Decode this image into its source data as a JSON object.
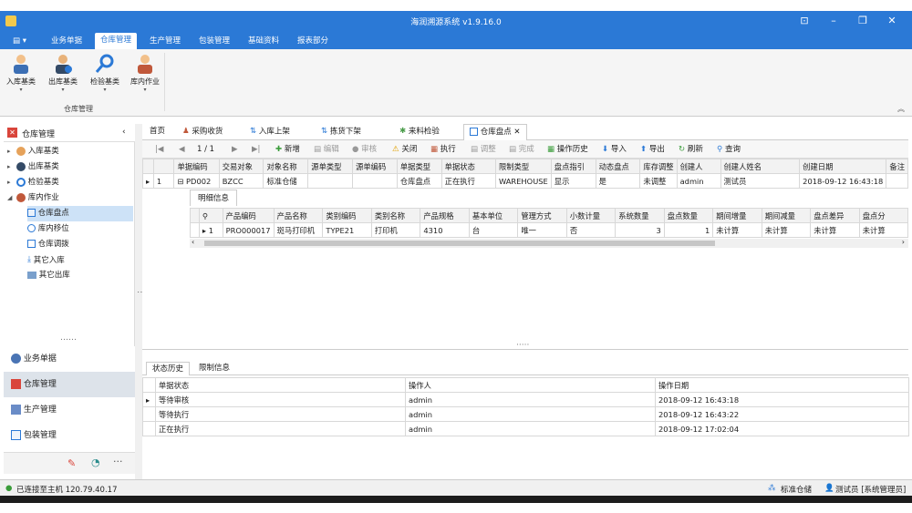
{
  "window": {
    "title": "海润溯源系统 v1.9.16.0"
  },
  "menu": {
    "items": [
      "业务单据",
      "仓库管理",
      "生产管理",
      "包装管理",
      "基础资料",
      "报表部分"
    ],
    "active": 1
  },
  "ribbon": {
    "buttons": [
      "入库基类",
      "出库基类",
      "检验基类",
      "库内作业"
    ],
    "group_label": "仓库管理"
  },
  "left": {
    "header": "仓库管理",
    "tree": [
      {
        "label": "入库基类",
        "level": 0,
        "expanded": false
      },
      {
        "label": "出库基类",
        "level": 0,
        "expanded": false
      },
      {
        "label": "检验基类",
        "level": 0,
        "expanded": false
      },
      {
        "label": "库内作业",
        "level": 0,
        "expanded": true
      },
      {
        "label": "仓库盘点",
        "level": 1,
        "selected": true
      },
      {
        "label": "库内移位",
        "level": 1
      },
      {
        "label": "仓库调拨",
        "level": 1
      },
      {
        "label": "其它入库",
        "level": 1
      },
      {
        "label": "其它出库",
        "level": 1
      }
    ],
    "nav": [
      "业务单据",
      "仓库管理",
      "生产管理",
      "包装管理"
    ],
    "nav_active": 1
  },
  "tabs": {
    "items": [
      "首页",
      "采购收货",
      "入库上架",
      "拣货下架",
      "来料检验",
      "仓库盘点"
    ],
    "active": 5
  },
  "toolbar": {
    "pager": "1 / 1",
    "buttons": [
      {
        "label": "新增",
        "enabled": true
      },
      {
        "label": "编辑",
        "enabled": false
      },
      {
        "label": "审核",
        "enabled": false
      },
      {
        "label": "关闭",
        "enabled": true
      },
      {
        "label": "执行",
        "enabled": true
      },
      {
        "label": "调整",
        "enabled": false
      },
      {
        "label": "完成",
        "enabled": false
      },
      {
        "label": "操作历史",
        "enabled": true
      },
      {
        "label": "导入",
        "enabled": true
      },
      {
        "label": "导出",
        "enabled": true
      },
      {
        "label": "刷新",
        "enabled": true
      },
      {
        "label": "查询",
        "enabled": true
      }
    ]
  },
  "main_grid": {
    "columns": [
      "单据编码",
      "交易对象",
      "对象名称",
      "源单类型",
      "源单编码",
      "单据类型",
      "单据状态",
      "限制类型",
      "盘点指引",
      "动态盘点",
      "库存调整",
      "创建人",
      "创建人姓名",
      "创建日期",
      "备注"
    ],
    "rows": [
      {
        "num": "1",
        "cells": [
          "PD002",
          "BZCC",
          "标准仓储",
          "",
          "",
          "仓库盘点",
          "正在执行",
          "WAREHOUSE",
          "显示",
          "是",
          "未调整",
          "admin",
          "测试员",
          "2018-09-12 16:43:18",
          ""
        ]
      }
    ]
  },
  "detail_grid": {
    "title": "明细信息",
    "columns": [
      "产品编码",
      "产品名称",
      "类别编码",
      "类别名称",
      "产品规格",
      "基本单位",
      "管理方式",
      "小数计量",
      "系统数量",
      "盘点数量",
      "期间增量",
      "期间减量",
      "盘点差异",
      "盘点分"
    ],
    "rows": [
      {
        "num": "1",
        "cells": [
          "PRO000017",
          "斑马打印机",
          "TYPE21",
          "打印机",
          "4310",
          "台",
          "唯一",
          "否",
          "3",
          "1",
          "未计算",
          "未计算",
          "未计算",
          "未计算"
        ]
      }
    ]
  },
  "bottom_tabs": {
    "items": [
      "状态历史",
      "限制信息"
    ],
    "active": 0
  },
  "history": {
    "columns": [
      "单据状态",
      "操作人",
      "操作日期"
    ],
    "rows": [
      [
        "等待审核",
        "admin",
        "2018-09-12 16:43:18"
      ],
      [
        "等待执行",
        "admin",
        "2018-09-12 16:43:22"
      ],
      [
        "正在执行",
        "admin",
        "2018-09-12 17:02:04"
      ]
    ]
  },
  "status": {
    "connection": "已连接至主机 120.79.40.17",
    "warehouse": "标准仓储",
    "user": "测试员 [系统管理员]"
  },
  "colors": {
    "accent": "#2b79d6"
  }
}
